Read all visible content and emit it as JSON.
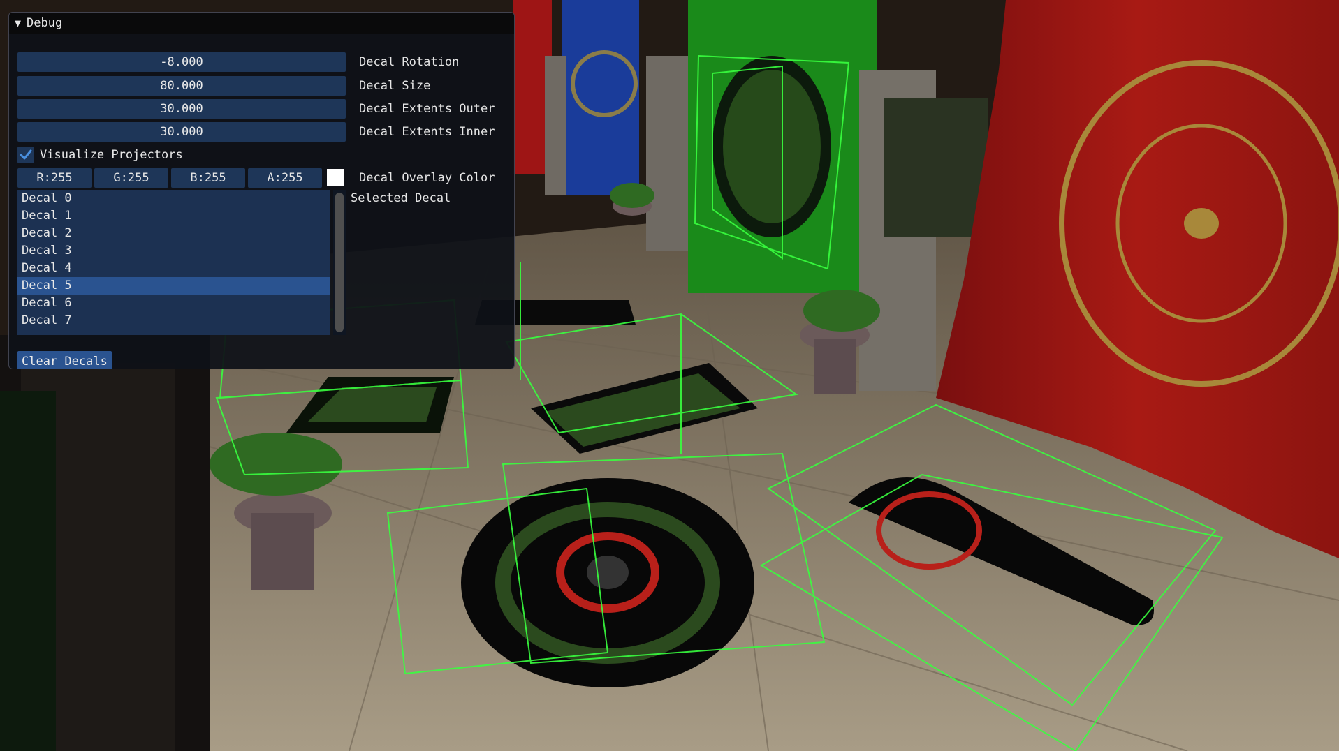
{
  "panel": {
    "title": "Debug",
    "sliders": [
      {
        "value": "-8.000",
        "label": "Decal Rotation"
      },
      {
        "value": "80.000",
        "label": "Decal Size"
      },
      {
        "value": "30.000",
        "label": "Decal Extents Outer"
      },
      {
        "value": "30.000",
        "label": "Decal Extents Inner"
      }
    ],
    "checkbox": {
      "label": "Visualize Projectors",
      "checked": true
    },
    "color": {
      "components": [
        "R:255",
        "G:255",
        "B:255",
        "A:255"
      ],
      "label": "Decal Overlay Color",
      "swatch": "#ffffff"
    },
    "list": {
      "label": "Selected Decal",
      "items": [
        "Decal 0",
        "Decal 1",
        "Decal 2",
        "Decal 3",
        "Decal 4",
        "Decal 5",
        "Decal 6",
        "Decal 7"
      ],
      "selected_index": 5
    },
    "clear_button": "Clear Decals"
  },
  "colors": {
    "projector_wire": "#39ff3f",
    "widget_bg": "#1e3658",
    "widget_active": "#2a5390",
    "checkmark": "#4a90e0"
  }
}
